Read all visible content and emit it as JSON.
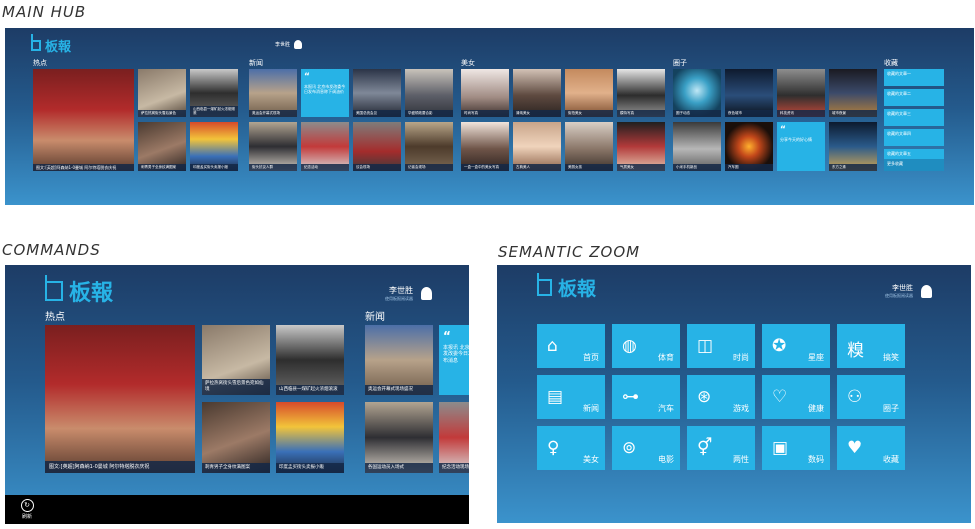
{
  "captions": {
    "main_hub": "MAIN HUB",
    "commands": "COMMANDS",
    "semantic_zoom": "SEMANTIC ZOOM"
  },
  "app": {
    "logo_text": "板報",
    "user_name": "李世胜",
    "user_sub": "使用板报阅读器"
  },
  "colors": {
    "accent": "#27b3e6",
    "panel_top": "#1d3c66",
    "panel_bottom": "#3b93cc",
    "command_bar": "#000000"
  },
  "hub": {
    "sections": [
      {
        "key": "hot",
        "title": "热点"
      },
      {
        "key": "news",
        "title": "新闻"
      },
      {
        "key": "beauty",
        "title": "美女"
      },
      {
        "key": "circle",
        "title": "圈子"
      },
      {
        "key": "fav",
        "title": "收藏"
      }
    ],
    "hot_hero_caption": "图文:[英超]阿森纳1-0曼城 阿尔特塔脱衣庆祝",
    "hot_captions": [
      "萨拉热窝街头雪后景色",
      "山西临县一煤矿起火浓烟滚滚",
      "刺青男子全身纹满图案",
      "印度孟买街头卖报小贩"
    ],
    "news_quote": "本报讯 北京市发改委今日发布消息称下调油价",
    "news_captions": [
      "奥运会开幕式现场",
      "美国总统会见",
      "华盛顿政要合影",
      "街头抗议人群",
      "纪念活动",
      "议会现场",
      "记者会现场",
      "人物专访",
      "外交会谈"
    ],
    "beauty_captions": [
      "时尚写真",
      "清纯美女",
      "街拍美女",
      "模特写真",
      "一盒一盒中的美女写真",
      "古典美人",
      "美丽女孩",
      "气质美女"
    ],
    "circle_captions": [
      "圈子动态",
      "夜色城市",
      "科技资讯",
      "城市夜景",
      "小米手机新品",
      "汽车圈",
      "东方之珠",
      "摄影圈"
    ],
    "circle_quote": "分享今天的好心情",
    "fav_items": [
      "收藏的文章一",
      "收藏的文章二",
      "收藏的文章三",
      "收藏的文章四",
      "收藏的文章五"
    ],
    "fav_more": "更多收藏"
  },
  "commands_view": {
    "hot_title": "热点",
    "news_title": "新闻",
    "hero_caption": "图文:[英超]阿森纳1-0曼城 阿尔特塔脱衣庆祝",
    "tile_captions": [
      "萨拉热窝街头雪后景色宛如仙境",
      "山西临县一煤矿起火浓烟滚滚",
      "刺青男子全身纹满图案",
      "印度孟买街头卖报小贩"
    ],
    "news_captions": [
      "奥运会开幕式现场盛况",
      "各国运动员入场式",
      "纪念活动现场"
    ],
    "quote": "本报讯 北京市发改委今日发布消息",
    "command_label": "刷新",
    "command_icon": "refresh-icon"
  },
  "zoom": {
    "tiles": [
      {
        "label": "首页",
        "icon": "home-icon",
        "glyph": "⌂"
      },
      {
        "label": "体育",
        "icon": "ball-icon",
        "glyph": "◍"
      },
      {
        "label": "时尚",
        "icon": "bag-icon",
        "glyph": "◫"
      },
      {
        "label": "星座",
        "icon": "star-icon",
        "glyph": "✪"
      },
      {
        "label": "搞笑",
        "icon": "character-icon",
        "glyph": "糗"
      },
      {
        "label": "新闻",
        "icon": "newspaper-icon",
        "glyph": "▤"
      },
      {
        "label": "汽车",
        "icon": "car-icon",
        "glyph": "⊶"
      },
      {
        "label": "游戏",
        "icon": "gamepad-icon",
        "glyph": "⊛"
      },
      {
        "label": "健康",
        "icon": "heartbeat-icon",
        "glyph": "♡"
      },
      {
        "label": "圈子",
        "icon": "people-icon",
        "glyph": "⚇"
      },
      {
        "label": "美女",
        "icon": "woman-icon",
        "glyph": "♀"
      },
      {
        "label": "电影",
        "icon": "film-reel-icon",
        "glyph": "⊚"
      },
      {
        "label": "两性",
        "icon": "gender-icon",
        "glyph": "⚥"
      },
      {
        "label": "数码",
        "icon": "picture-icon",
        "glyph": "▣"
      },
      {
        "label": "收藏",
        "icon": "heart-icon",
        "glyph": "♥"
      }
    ]
  }
}
